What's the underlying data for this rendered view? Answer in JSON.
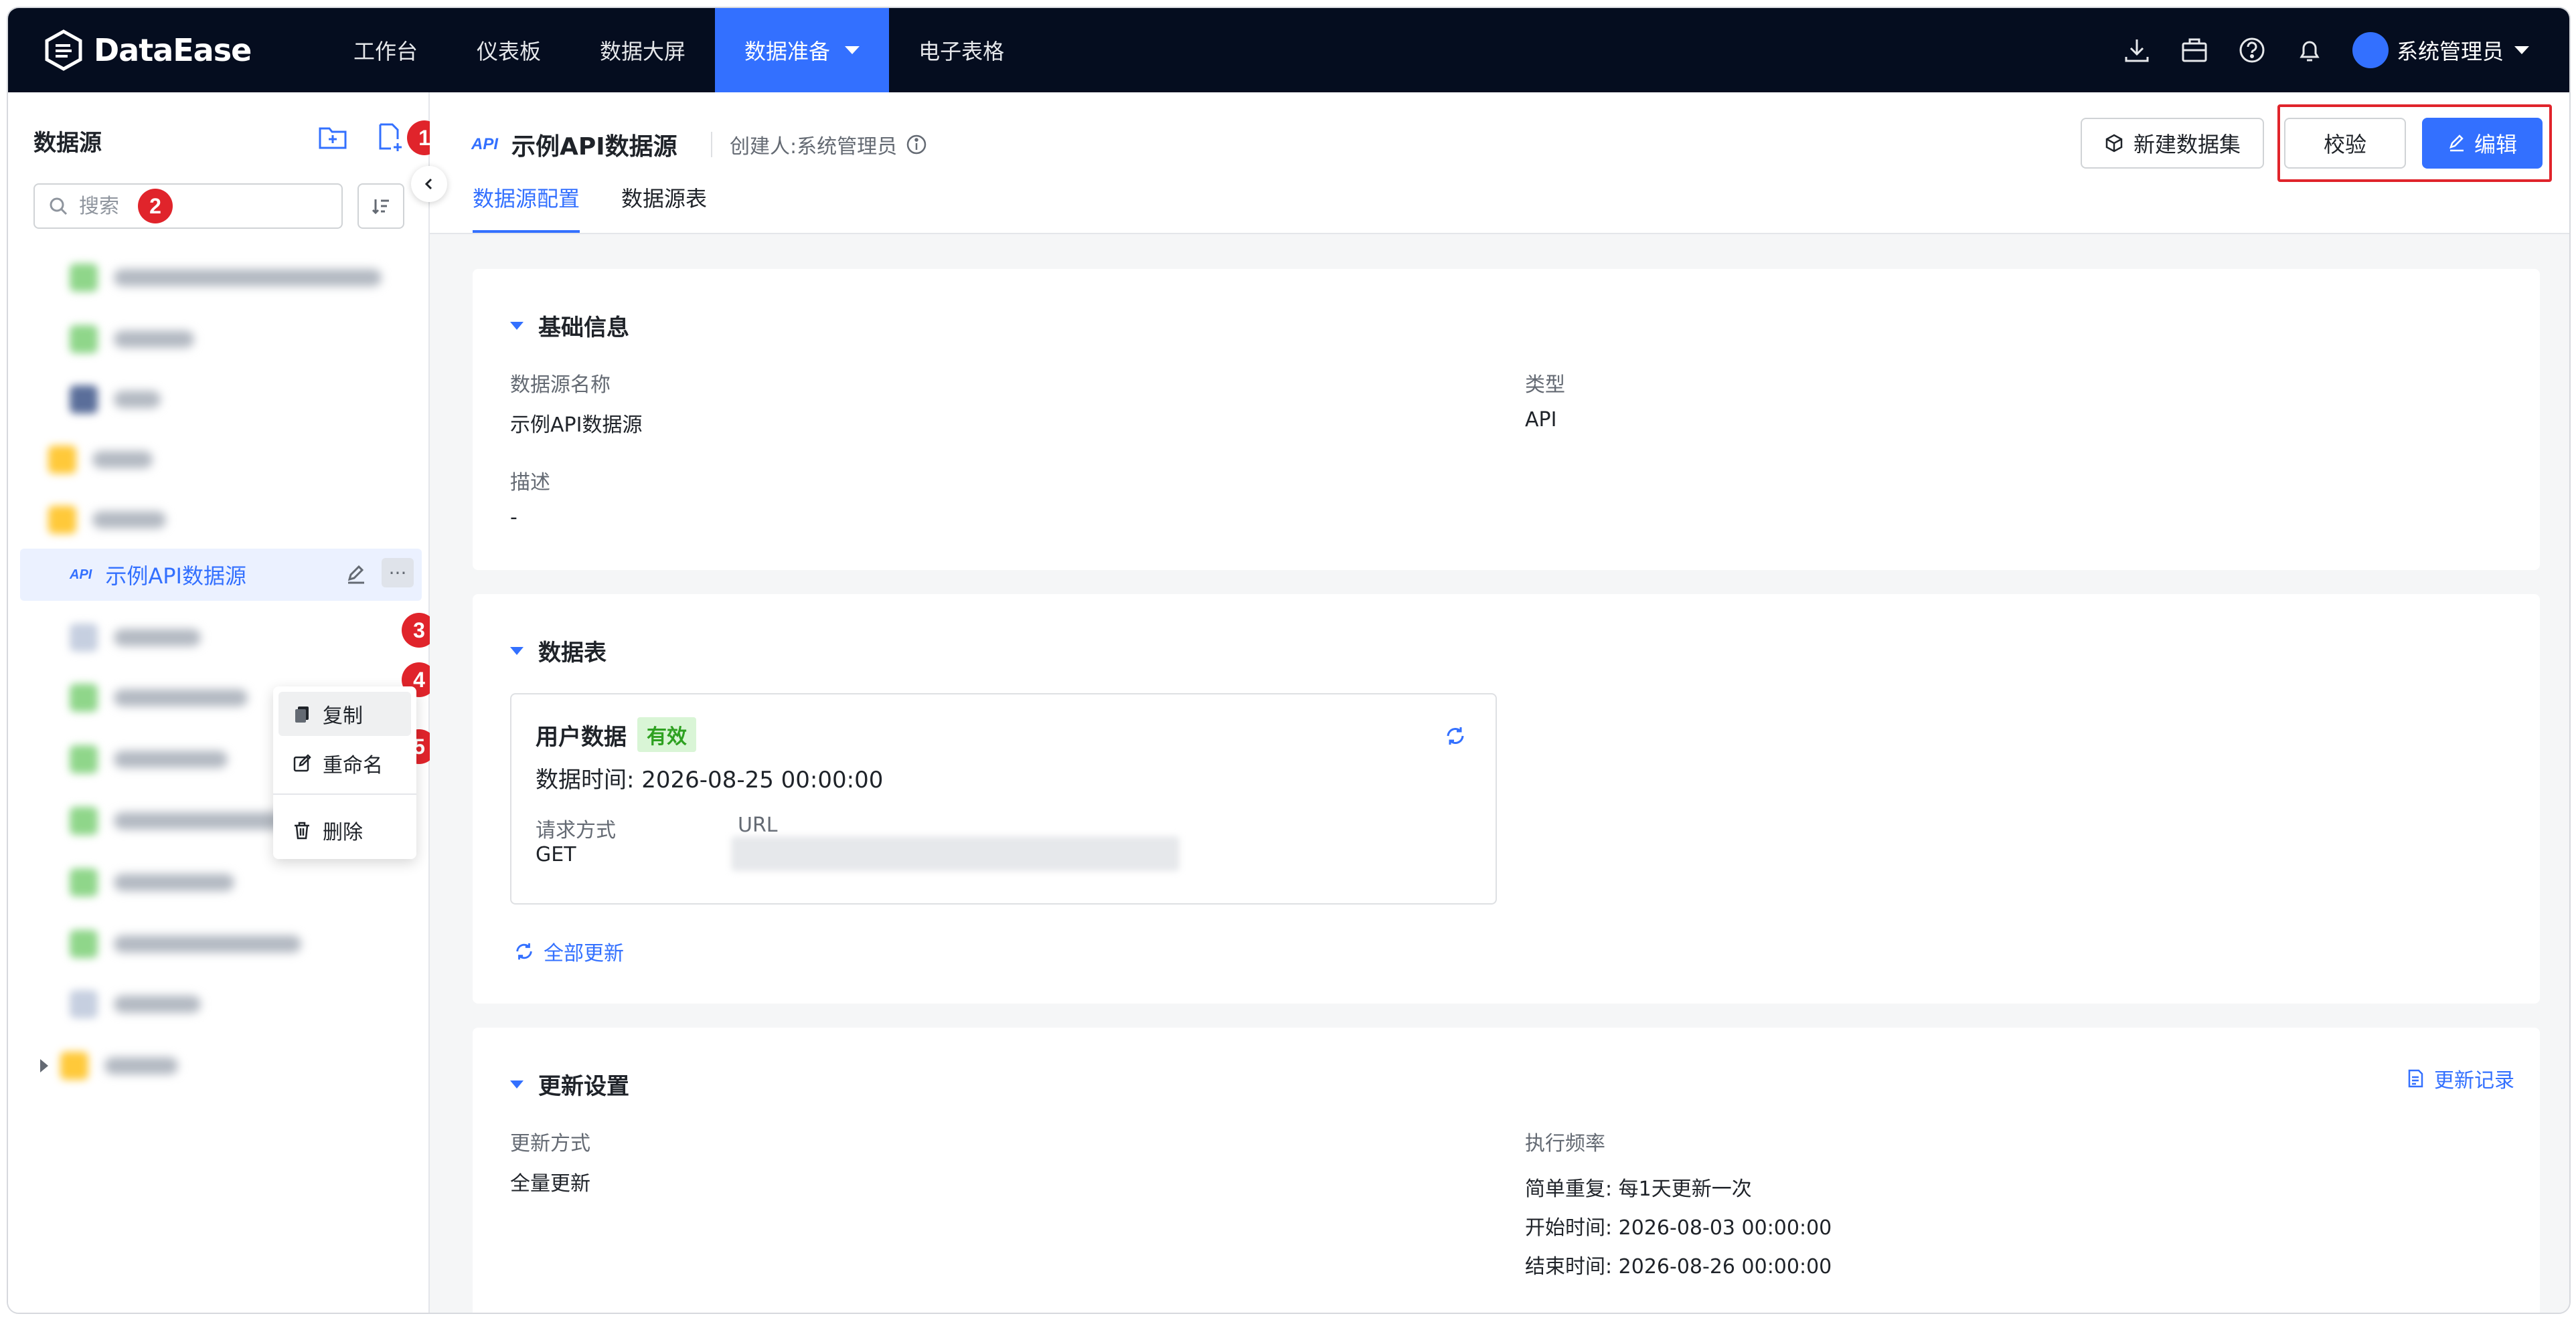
{
  "header": {
    "logo_text": "DataEase",
    "nav": [
      "工作台",
      "仪表板",
      "数据大屏",
      "数据准备",
      "电子表格"
    ],
    "user_name": "系统管理员"
  },
  "sidebar": {
    "title": "数据源",
    "search_placeholder": "搜索",
    "active_item": {
      "tag": "API",
      "label": "示例API数据源"
    },
    "context_menu": [
      "复制",
      "重命名",
      "删除"
    ]
  },
  "badges": [
    "1",
    "2",
    "3",
    "4",
    "5"
  ],
  "main": {
    "title": "示例API数据源",
    "title_tag": "API",
    "creator": "创建人:系统管理员",
    "tabs": [
      "数据源配置",
      "数据源表"
    ],
    "buttons": {
      "new_dataset": "新建数据集",
      "validate": "校验",
      "edit": "编辑"
    },
    "basic": {
      "title": "基础信息",
      "name_label": "数据源名称",
      "name_value": "示例API数据源",
      "type_label": "类型",
      "type_value": "API",
      "desc_label": "描述",
      "desc_value": "-"
    },
    "tables": {
      "title": "数据表",
      "table_name": "用户数据",
      "status": "有效",
      "time_text": "数据时间:  2026-08-25 00:00:00",
      "method_label": "请求方式",
      "method_value": "GET",
      "url_label": "URL",
      "refresh_all": "全部更新"
    },
    "update": {
      "title": "更新设置",
      "history_link": "更新记录",
      "mode_label": "更新方式",
      "mode_value": "全量更新",
      "freq_label": "执行频率",
      "freq_lines": [
        "简单重复: 每1天更新一次",
        "开始时间: 2026-08-03 00:00:00",
        "结束时间: 2026-08-26 00:00:00"
      ]
    }
  },
  "colors": {
    "primary": "#3370ff",
    "header_bg": "#050d1f",
    "badge": "#e0242b",
    "valid_bg": "#d9f5d6",
    "valid_fg": "#2ea121"
  }
}
